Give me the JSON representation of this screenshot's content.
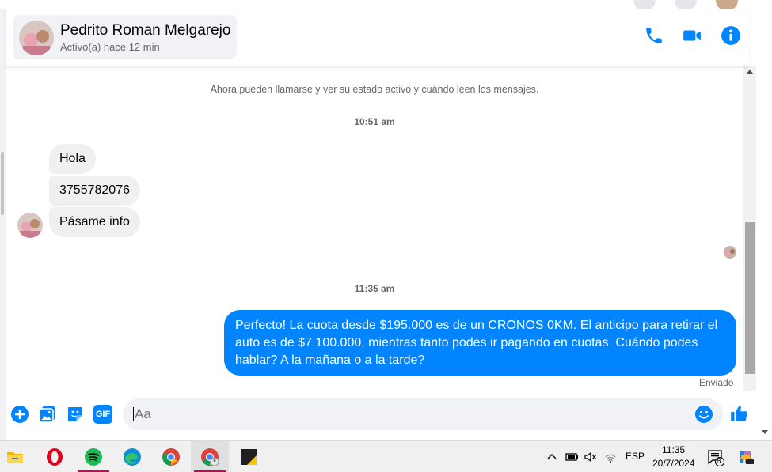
{
  "header": {
    "contact_name": "Pedrito Roman Melgarejo",
    "status": "Activo(a) hace 12 min",
    "icons": [
      "phone-icon",
      "video-icon",
      "info-icon"
    ]
  },
  "chat": {
    "system_message": "Ahora pueden llamarse y ver su estado activo y cuándo leen los mensajes.",
    "time_1": "10:51 am",
    "incoming": [
      "Hola",
      "3755782076",
      "Pásame info"
    ],
    "time_2": "11:35 am",
    "outgoing": "Perfecto! La cuota desde $195.000 es de un CRONOS 0KM. El anticipo para retirar el auto es de $7.100.000, mientras tanto podes ir pagando en cuotas. Cuándo podes hablar? A la mañana o a la tarde?",
    "sent_label": "Enviado"
  },
  "composer": {
    "placeholder": "Aa",
    "gif_label": "GIF",
    "icons": [
      "plus-icon",
      "image-icon",
      "sticker-icon",
      "gif-icon",
      "emoji-icon",
      "thumbs-up-icon"
    ]
  },
  "taskbar": {
    "language": "ESP",
    "time": "11:35",
    "date": "20/7/2024",
    "notification_count": "8",
    "apps": [
      "file-explorer-icon",
      "opera-icon",
      "spotify-icon",
      "edge-icon",
      "chrome-icon",
      "chrome-profile-icon",
      "sticky-app-icon"
    ]
  },
  "colors": {
    "accent": "#0084ff",
    "incoming_bubble": "#f0f0f0",
    "secondary_text": "#65676b"
  }
}
